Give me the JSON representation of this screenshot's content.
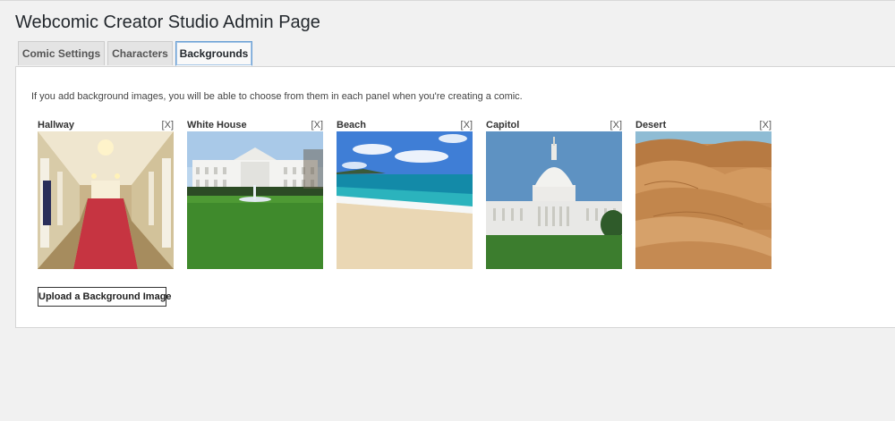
{
  "page": {
    "title": "Webcomic Creator Studio Admin Page"
  },
  "tabs": [
    {
      "label": "Comic Settings",
      "active": false
    },
    {
      "label": "Characters",
      "active": false
    },
    {
      "label": "Backgrounds",
      "active": true
    }
  ],
  "backgrounds_panel": {
    "intro": "If you add background images, you will be able to choose from them in each panel when you're creating a comic.",
    "items": [
      {
        "name": "Hallway",
        "remove_label": "[X]",
        "image": "hallway-image"
      },
      {
        "name": "White House",
        "remove_label": "[X]",
        "image": "white-house-image"
      },
      {
        "name": "Beach",
        "remove_label": "[X]",
        "image": "beach-image"
      },
      {
        "name": "Capitol",
        "remove_label": "[X]",
        "image": "capitol-image"
      },
      {
        "name": "Desert",
        "remove_label": "[X]",
        "image": "desert-image"
      }
    ],
    "upload_label": "Upload a Background Image"
  },
  "colors": {
    "page_bg": "#f1f1f1",
    "panel_bg": "#ffffff",
    "active_tab_border": "#6a9fd4",
    "text": "#23282d"
  }
}
